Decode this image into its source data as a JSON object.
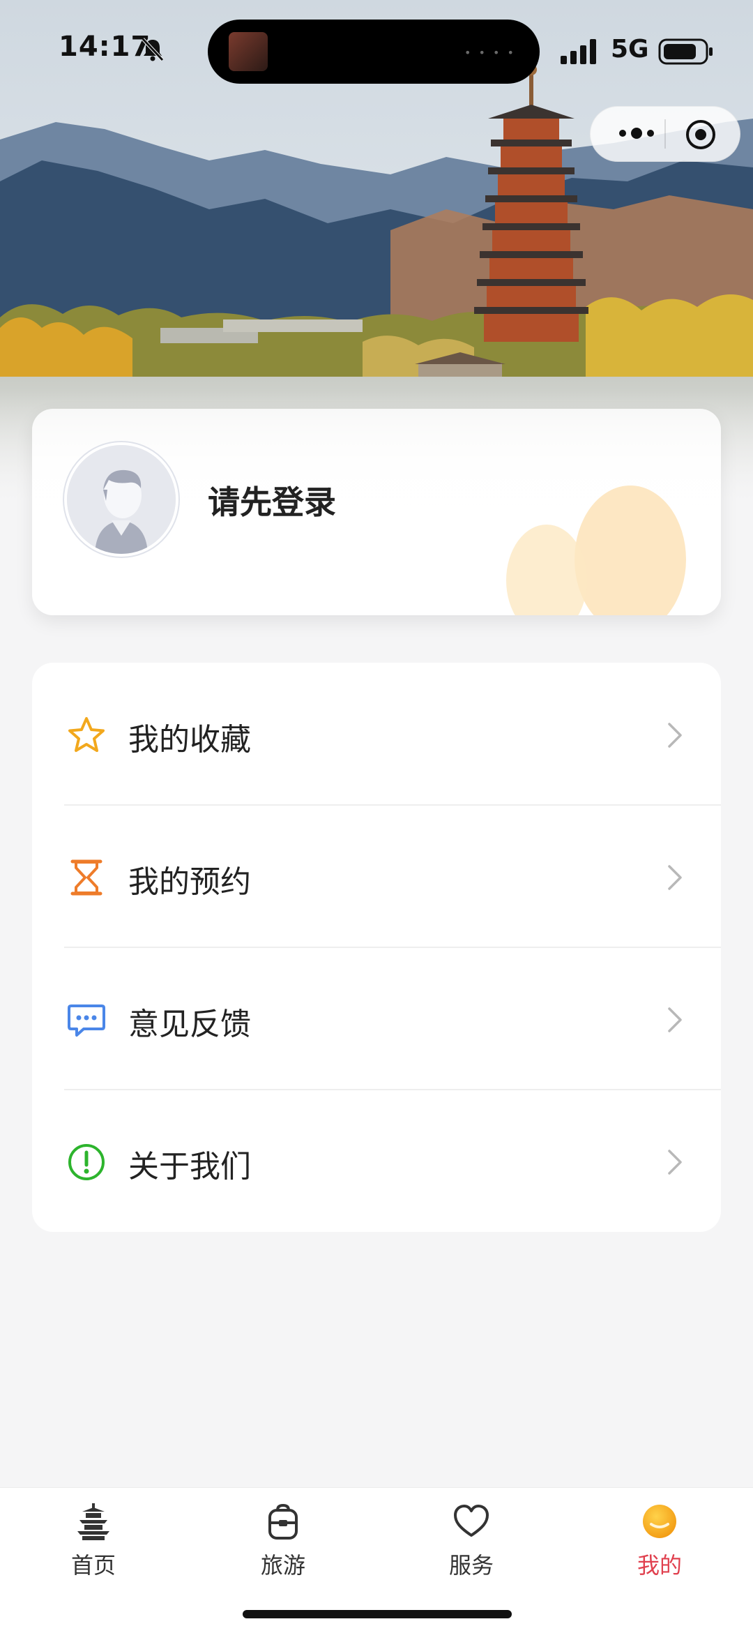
{
  "status_bar": {
    "time": "14:17",
    "network": "5G",
    "icons": [
      "bell-muted-icon",
      "signal-icon",
      "battery-icon"
    ]
  },
  "capsule": {
    "icons": [
      "more-icon",
      "close-target-icon"
    ]
  },
  "login_card": {
    "prompt": "请先登录",
    "avatar_icon": "avatar-icon"
  },
  "menu": {
    "items": [
      {
        "label": "我的收藏",
        "icon": "star-icon",
        "color": "#f2a81d"
      },
      {
        "label": "我的预约",
        "icon": "hourglass-icon",
        "color": "#ee7c2a"
      },
      {
        "label": "意见反馈",
        "icon": "chat-icon",
        "color": "#4a86e8"
      },
      {
        "label": "关于我们",
        "icon": "info-icon",
        "color": "#2db42d"
      }
    ]
  },
  "tab_bar": {
    "tabs": [
      {
        "label": "首页",
        "icon": "pagoda-icon",
        "active": false
      },
      {
        "label": "旅游",
        "icon": "backpack-icon",
        "active": false
      },
      {
        "label": "服务",
        "icon": "heart-icon",
        "active": false
      },
      {
        "label": "我的",
        "icon": "mine-icon",
        "active": true
      }
    ],
    "active_color": "#e0404e"
  }
}
